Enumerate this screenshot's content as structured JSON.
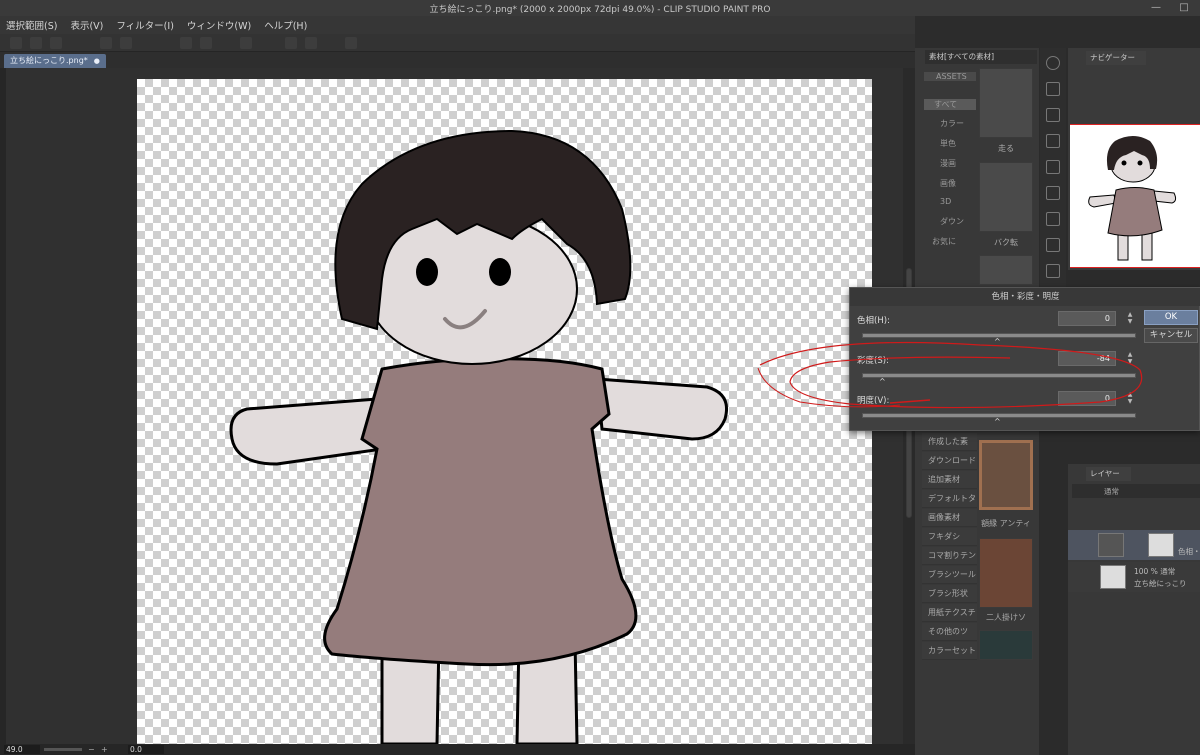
{
  "app": {
    "title": "立ち絵にっこり.png* (2000 x 2000px 72dpi 49.0%) - CLIP STUDIO PAINT PRO",
    "window_controls": [
      "—",
      "□"
    ]
  },
  "menu": [
    "選択範囲(S)",
    "表示(V)",
    "フィルター(I)",
    "ウィンドウ(W)",
    "ヘルプ(H)"
  ],
  "document_tab": {
    "label": "立ち絵にっこり.png*",
    "close": "●"
  },
  "status": {
    "zoom": "49.0",
    "angle": "0.0",
    "minus": "−",
    "plus": "+"
  },
  "materials": {
    "header": "素材[すべての素材]",
    "tree": [
      "ASSETS",
      "すべて",
      "カラー",
      "単色",
      "漫画",
      "画像",
      "3D",
      "ダウン",
      "お気に"
    ],
    "list": [
      "作成した素",
      "ダウンロード",
      "追加素材",
      "デフォルトタ",
      "画像素材",
      "フキダシ",
      "コマ割りテン",
      "ブラシツール",
      "ブラシ形状",
      "用紙テクスチ",
      "その他のツ",
      "カラーセット"
    ],
    "thumb_labels": [
      "走る",
      "バク転",
      "額縁 アンティ",
      "二人掛けソ"
    ]
  },
  "navigator": {
    "header": "ナビゲーター"
  },
  "dialog": {
    "title": "色相・彩度・明度",
    "hue_label": "色相(H):",
    "hue_value": "0",
    "saturation_label": "彩度(S):",
    "saturation_value": "-84",
    "value_label": "明度(V):",
    "value_value": "0",
    "ok": "OK",
    "cancel": "キャンセル",
    "spin_up": "▲",
    "spin_down": "▼",
    "knob": "^"
  },
  "layers": {
    "header": "レイヤー",
    "blend_mode": "通常",
    "rows": [
      {
        "line1": "",
        "line2": "色相・彩"
      },
      {
        "line1": "100 % 通常",
        "line2": "立ち絵にっこり"
      }
    ]
  },
  "colors": {
    "accent": "#6b7f9e",
    "dress": "#957c7c",
    "skin": "#e2dcdc",
    "hair": "#2a2222",
    "annotation": "#d01a1a"
  }
}
